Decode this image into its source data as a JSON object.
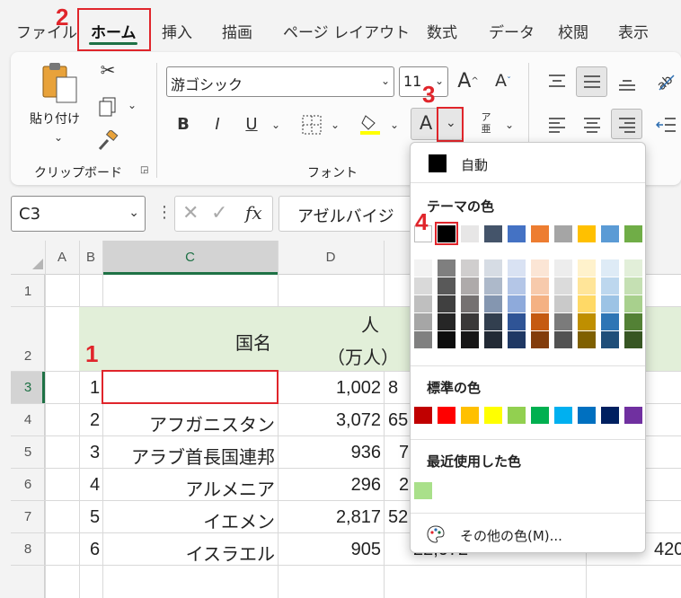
{
  "tabs": [
    "ファイル",
    "ホーム",
    "挿入",
    "描画",
    "ページ レイアウト",
    "数式",
    "データ",
    "校閲",
    "表示"
  ],
  "callouts": [
    "1",
    "2",
    "3",
    "4"
  ],
  "clipboard": {
    "paste": "貼り付け",
    "group": "クリップボード"
  },
  "font": {
    "name": "游ゴシック",
    "size": "11",
    "group": "フォント",
    "bold": "B",
    "italic": "I",
    "underline": "U",
    "font_color_glyph": "A",
    "phonetic_top": "ア",
    "phonetic_bottom": "亜"
  },
  "formula_bar": {
    "name_box": "C3",
    "fx": "fx",
    "content": "アゼルバイジ"
  },
  "columns": [
    "A",
    "B",
    "C",
    "D"
  ],
  "rows": [
    "1",
    "2",
    "3",
    "4",
    "5",
    "6",
    "7",
    "8"
  ],
  "table": {
    "header_name": "国名",
    "header_pop_line1": "人",
    "header_pop_line2": "（万人）",
    "rows": [
      {
        "no": "1",
        "name": "",
        "pop": "1,002",
        "e": "8"
      },
      {
        "no": "2",
        "name": "アフガニスタン",
        "pop": "3,072",
        "e": "65"
      },
      {
        "no": "3",
        "name": "アラブ首長国連邦",
        "pop": "936",
        "e": "7"
      },
      {
        "no": "4",
        "name": "アルメニア",
        "pop": "296",
        "e": "2"
      },
      {
        "no": "5",
        "name": "イエメン",
        "pop": "2,817",
        "e": "52"
      },
      {
        "no": "6",
        "name": "イスラエル",
        "pop": "905",
        "e": "22,072"
      }
    ],
    "row8_f": "420"
  },
  "color_menu": {
    "auto": "自動",
    "theme_title": "テーマの色",
    "standard_title": "標準の色",
    "recent_title": "最近使用した色",
    "more": "その他の色(M)...",
    "theme_top": [
      "#ffffff",
      "#000000",
      "#e7e6e6",
      "#44546a",
      "#4472c4",
      "#ed7d31",
      "#a5a5a5",
      "#ffc000",
      "#5b9bd5",
      "#70ad47"
    ],
    "theme_shades": [
      [
        "#f2f2f2",
        "#d9d9d9",
        "#bfbfbf",
        "#a6a6a6",
        "#808080"
      ],
      [
        "#7f7f7f",
        "#595959",
        "#404040",
        "#262626",
        "#0d0d0d"
      ],
      [
        "#d0cece",
        "#aeaaaa",
        "#757171",
        "#3a3838",
        "#171616"
      ],
      [
        "#d6dce4",
        "#adb9ca",
        "#8496b0",
        "#323f4f",
        "#222a35"
      ],
      [
        "#d9e2f3",
        "#b4c6e7",
        "#8eaadb",
        "#2f5496",
        "#1f3864"
      ],
      [
        "#fbe5d5",
        "#f7caac",
        "#f4b183",
        "#c55a11",
        "#833c0b"
      ],
      [
        "#ededed",
        "#dbdbdb",
        "#c9c9c9",
        "#7b7b7b",
        "#525252"
      ],
      [
        "#fff2cc",
        "#ffe599",
        "#ffd966",
        "#bf8f00",
        "#7f6000"
      ],
      [
        "#deebf6",
        "#bdd7ee",
        "#9cc3e5",
        "#2e75b5",
        "#1f4e79"
      ],
      [
        "#e2efd9",
        "#c5e0b3",
        "#a8d08d",
        "#538135",
        "#375623"
      ]
    ],
    "standard": [
      "#c00000",
      "#ff0000",
      "#ffc000",
      "#ffff00",
      "#92d050",
      "#00b050",
      "#00b0f0",
      "#0070c0",
      "#002060",
      "#7030a0"
    ],
    "recent": [
      "#a9e08a"
    ]
  }
}
